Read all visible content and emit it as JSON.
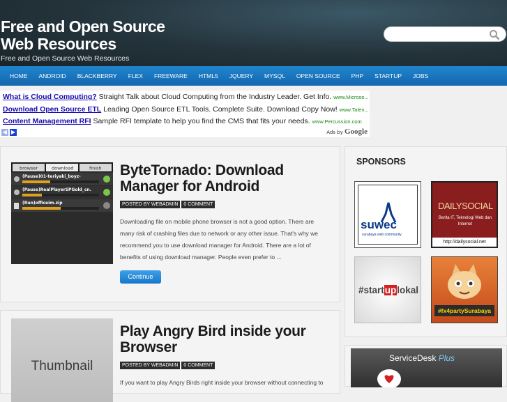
{
  "site": {
    "title": "Free and Open Source Web Resources",
    "tagline": "Free and Open Source Web Resources"
  },
  "search": {
    "placeholder": ""
  },
  "nav": [
    "HOME",
    "ANDROID",
    "BLACKBERRY",
    "FLEX",
    "FREEWARE",
    "HTML5",
    "JQUERY",
    "MYSQL",
    "OPEN SOURCE",
    "PHP",
    "STARTUP",
    "JOBS"
  ],
  "ads": [
    {
      "title": "What is Cloud Computing?",
      "text": "Straight Talk about Cloud Computing from the Industry Leader. Get Info.",
      "url": "www.Microso..."
    },
    {
      "title": "Download Open Source ETL",
      "text": "Leading Open Source ETL Tools. Complete Suite. Download Copy Now!",
      "url": "www.Talen..."
    },
    {
      "title": "Content Management RFI",
      "text": "Sample RFI template to help you find the CMS that fits your needs.",
      "url": "www.Percussion.com"
    }
  ],
  "ads_by": {
    "label": "Ads by",
    "brand": "Google"
  },
  "posts": [
    {
      "title": "ByteTornado: Download Manager for Android",
      "author": "POSTED BY WEBADMIN",
      "comments": "0 COMMENT",
      "excerpt": "Downloading file on mobile phone browser is not a good option. There are many risk of crashing files due to network or any other issue. That's why we recommend you to use download manager for Android. There are a lot of benefits of using download manager. People even prefer to ...",
      "continue": "Continue",
      "thumb_tabs": [
        "browser",
        "download",
        "finish"
      ],
      "thumb_items": [
        "(Pause)01-teriyaki_boyz-",
        "(Pause)RealPlayerSPGold_cn.",
        "(Run)officeim.zip"
      ]
    },
    {
      "title": "Play Angry Bird inside your Browser",
      "author": "POSTED BY WEBADMIN",
      "comments": "0 COMMENT",
      "excerpt": "If you want to play Angry Birds right inside your browser without connecting to",
      "thumb_label": "Thumbnail"
    }
  ],
  "sidebar": {
    "sponsors_title": "SPONSORS",
    "sponsors": [
      {
        "name": "suwec",
        "sub": "surabaya web community"
      },
      {
        "name": "DAILYSOCIAL",
        "sub": "Berita IT, Teknologi Web dan Internet",
        "url": "http://dailysocial.net"
      },
      {
        "name": "#startuplokal",
        "part1": "#start",
        "part2": "up",
        "part3": "lokal"
      },
      {
        "name": "#fx4partySurabaya"
      }
    ],
    "servicedesk": {
      "label": "ServiceDesk",
      "plus": "Plus"
    }
  },
  "colors": {
    "nav": "#1a74bf",
    "header": "#24333b",
    "ad_link": "#1a0dab",
    "ad_url": "#1a8a1a"
  }
}
